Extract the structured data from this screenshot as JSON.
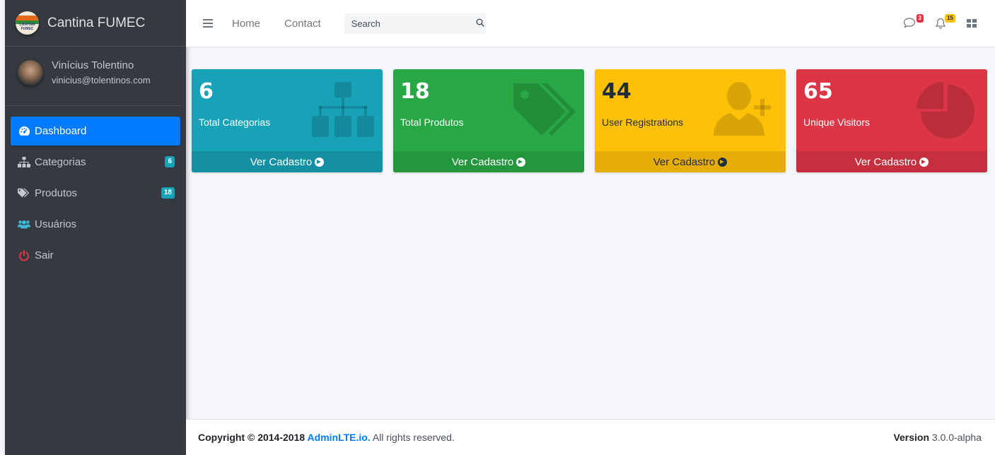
{
  "brand": {
    "name": "Cantina FUMEC",
    "logo_text": "CANTINA FUMEC"
  },
  "user": {
    "name": "Vinícius Tolentino",
    "email": "vinicius@tolentinos.com"
  },
  "sidebar": {
    "items": [
      {
        "label": "Dashboard",
        "icon": "dashboard-icon",
        "active": true
      },
      {
        "label": "Categorias",
        "icon": "sitemap-icon",
        "badge": "6"
      },
      {
        "label": "Produtos",
        "icon": "tags-icon",
        "badge": "18"
      },
      {
        "label": "Usuários",
        "icon": "users-icon"
      },
      {
        "label": "Sair",
        "icon": "power-icon"
      }
    ]
  },
  "topbar": {
    "links": [
      "Home",
      "Contact"
    ],
    "search_placeholder": "Search",
    "messages_badge": "3",
    "notifications_badge": "15"
  },
  "boxes": [
    {
      "value": "6",
      "label": "Total Categorias",
      "footer": "Ver Cadastro",
      "color": "#17a2b8",
      "icon": "sitemap-icon"
    },
    {
      "value": "18",
      "label": "Total Produtos",
      "footer": "Ver Cadastro",
      "color": "#28a745",
      "icon": "tags-icon"
    },
    {
      "value": "44",
      "label": "User Registrations",
      "footer": "Ver Cadastro",
      "color": "#ffc107",
      "icon": "user-plus-icon"
    },
    {
      "value": "65",
      "label": "Unique Visitors",
      "footer": "Ver Cadastro",
      "color": "#dc3545",
      "icon": "pie-chart-icon"
    }
  ],
  "footer": {
    "copyright_prefix": "Copyright © 2014-2018",
    "link_text": "AdminLTE.io.",
    "copyright_suffix": " All rights reserved.",
    "version_label": "Version",
    "version_value": " 3.0.0-alpha"
  }
}
